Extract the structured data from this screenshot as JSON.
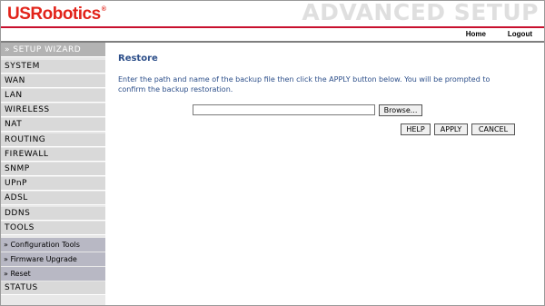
{
  "brand": {
    "logo_text": "USRobotics",
    "logo_mark": "®",
    "banner_text": "ADVANCED SETUP"
  },
  "topnav": {
    "home": "Home",
    "logout": "Logout"
  },
  "sidebar": {
    "wizard": "» SETUP WIZARD",
    "items": [
      "SYSTEM",
      "WAN",
      "LAN",
      "WIRELESS",
      "NAT",
      "ROUTING",
      "FIREWALL",
      "SNMP",
      "UPnP",
      "ADSL",
      "DDNS",
      "TOOLS"
    ],
    "tools_sub": [
      "» Configuration Tools",
      "» Firmware Upgrade",
      "» Reset"
    ],
    "status": "STATUS"
  },
  "main": {
    "title": "Restore",
    "description": "Enter the path and name of the backup file then click the APPLY button below. You will be prompted to confirm the backup restoration.",
    "file_value": "",
    "browse_label": "Browse...",
    "help_label": "HELP",
    "apply_label": "APPLY",
    "cancel_label": "CANCEL"
  },
  "colors": {
    "brand_red": "#e2231a",
    "title_blue": "#2d4f8a",
    "sidebar_bg": "#d9d9d9",
    "submenu_bg": "#b8b8c4"
  }
}
